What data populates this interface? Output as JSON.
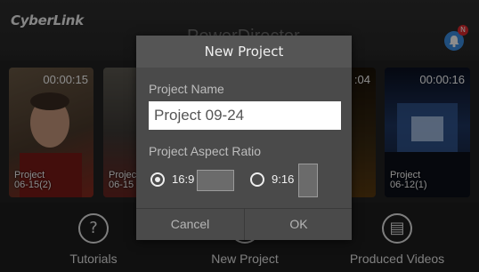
{
  "header": {
    "logo_text": "CyberLink",
    "title": "PowerDirector",
    "notification_badge": "N"
  },
  "thumbnails": [
    {
      "duration": "00:00:15",
      "name": "Project\n06-15(2)"
    },
    {
      "duration": "",
      "name": "Projec\n06-15"
    },
    {
      "duration": ":04",
      "name": ""
    },
    {
      "duration": "00:00:16",
      "name": "Project\n06-12(1)"
    }
  ],
  "nav": {
    "tutorials": "Tutorials",
    "new_project": "New Project",
    "produced_videos": "Produced Videos"
  },
  "dialog": {
    "title": "New Project",
    "name_label": "Project Name",
    "name_value": "Project 09-24",
    "ratio_label": "Project Aspect Ratio",
    "ratio_options": [
      {
        "label": "16:9",
        "selected": true
      },
      {
        "label": "9:16",
        "selected": false
      }
    ],
    "cancel_label": "Cancel",
    "ok_label": "OK"
  },
  "colors": {
    "dialog_bg": "#4a4a4a",
    "badge": "#e0282e",
    "bell": "#3b8fe3"
  }
}
